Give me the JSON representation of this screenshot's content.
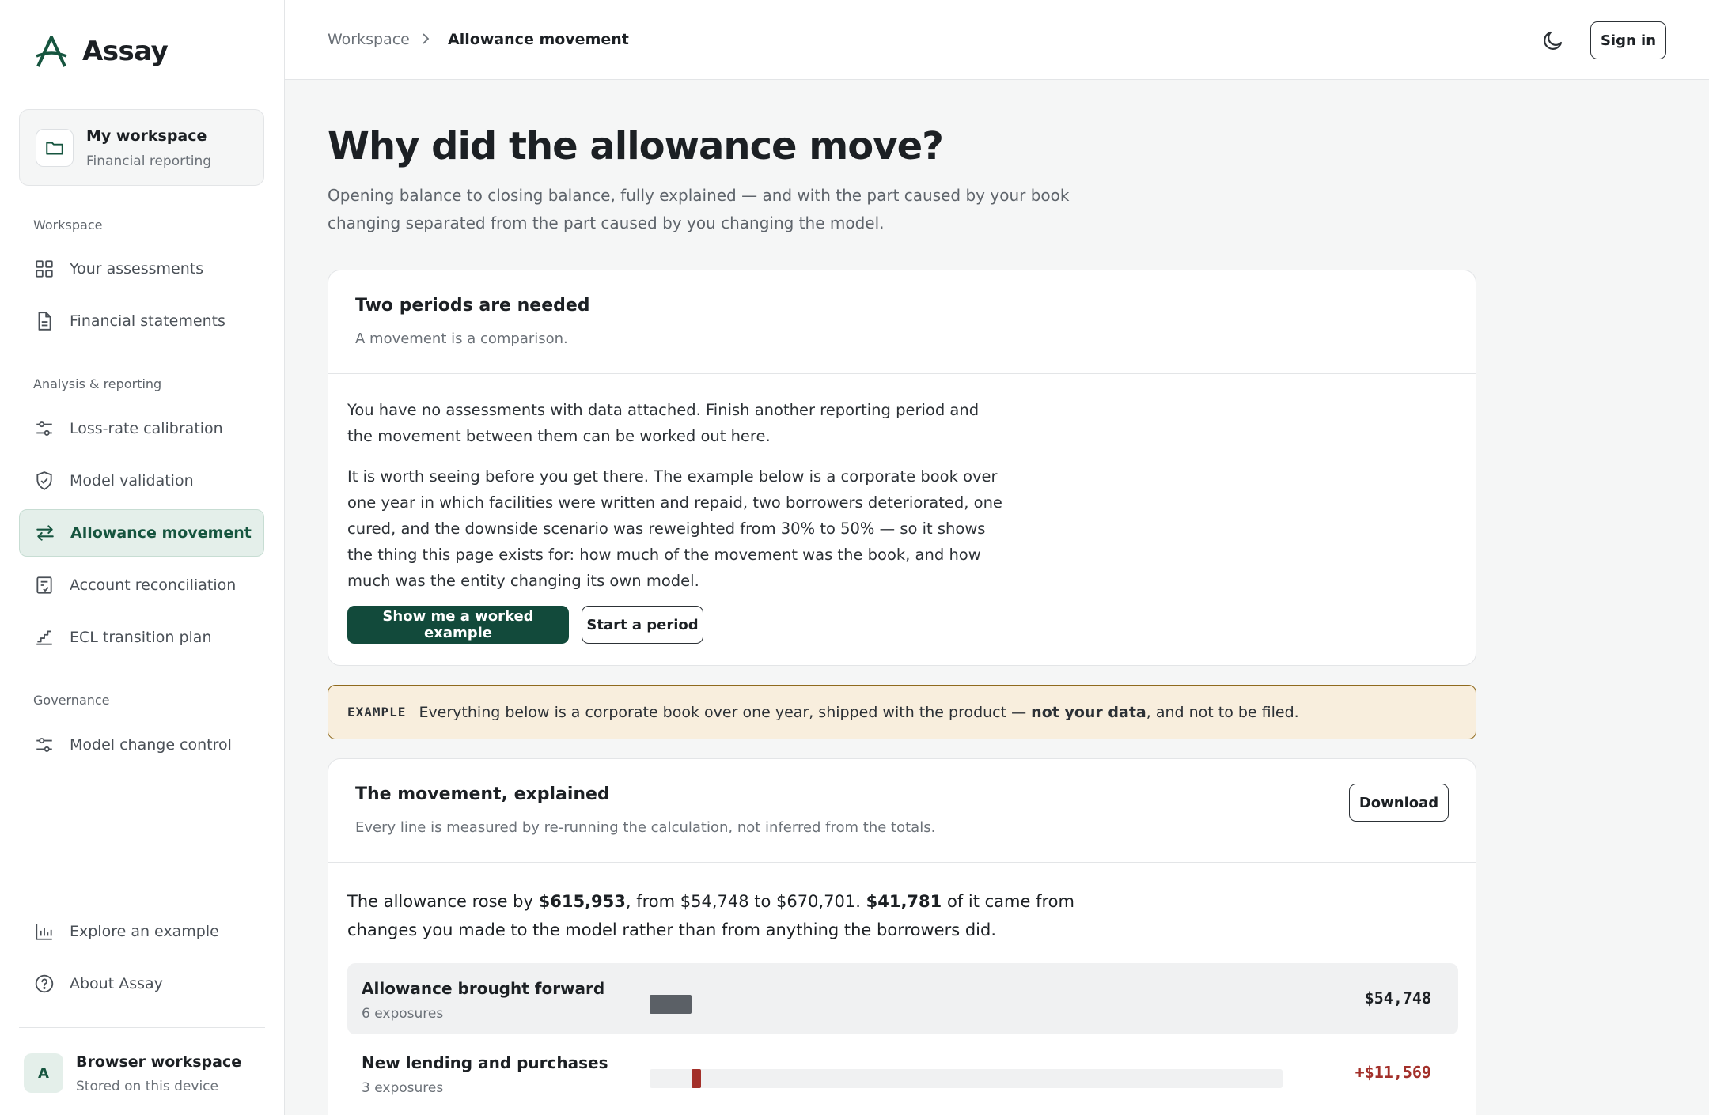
{
  "app": {
    "name": "Assay"
  },
  "workspace": {
    "title": "My workspace",
    "subtitle": "Financial reporting"
  },
  "sidebar": {
    "sections": [
      {
        "label": "Workspace",
        "items": [
          {
            "label": "Your assessments",
            "icon": "grid-icon"
          },
          {
            "label": "Financial statements",
            "icon": "document-icon"
          }
        ]
      },
      {
        "label": "Analysis & reporting",
        "items": [
          {
            "label": "Loss-rate calibration",
            "icon": "sliders-icon"
          },
          {
            "label": "Model validation",
            "icon": "shield-check-icon"
          },
          {
            "label": "Allowance movement",
            "icon": "swap-arrows-icon",
            "active": true
          },
          {
            "label": "Account reconciliation",
            "icon": "checklist-icon"
          },
          {
            "label": "ECL transition plan",
            "icon": "stairs-icon"
          }
        ]
      },
      {
        "label": "Governance",
        "items": [
          {
            "label": "Model change control",
            "icon": "sliders-icon"
          }
        ]
      }
    ],
    "footer_items": [
      {
        "label": "Explore an example",
        "icon": "bar-chart-icon"
      },
      {
        "label": "About Assay",
        "icon": "help-circle-icon"
      }
    ],
    "account": {
      "initial": "A",
      "title": "Browser workspace",
      "subtitle": "Stored on this device"
    }
  },
  "topbar": {
    "breadcrumb_root": "Workspace",
    "breadcrumb_current": "Allowance movement",
    "signin_label": "Sign in"
  },
  "page": {
    "title": "Why did the allowance move?",
    "lede": "Opening balance to closing balance, fully explained — and with the part caused by your book changing separated from the part caused by you changing the model."
  },
  "empty_card": {
    "title": "Two periods are needed",
    "subtitle": "A movement is a comparison.",
    "para1": "You have no assessments with data attached. Finish another reporting period and the movement between them can be worked out here.",
    "para2": "It is worth seeing before you get there. The example below is a corporate book over one year in which facilities were written and repaid, two borrowers deteriorated, one cured, and the downside scenario was reweighted from 30% to 50% — so it shows the thing this page exists for: how much of the movement was the book, and how much was the entity changing its own model.",
    "primary_label": "Show me a worked example",
    "secondary_label": "Start a period"
  },
  "banner": {
    "tag": "EXAMPLE",
    "text_before": "Everything below is a corporate book over one year, shipped with the product — ",
    "text_bold": "not your data",
    "text_after": ", and not to be filed."
  },
  "movement_card": {
    "title": "The movement, explained",
    "subtitle": "Every line is measured by re-running the calculation, not inferred from the totals.",
    "download_label": "Download",
    "summary": {
      "p1": "The allowance rose by ",
      "b1": "$615,953",
      "p2": ", from $54,748 to $670,701. ",
      "b2": "$41,781",
      "p3": " of it came from changes you made to the model rather than from anything the borrowers did."
    },
    "rows": [
      {
        "label": "Allowance brought forward",
        "count": "6 exposures",
        "value": "$54,748",
        "amount": 54748,
        "kind": "opening",
        "color": "#5b6066"
      },
      {
        "label": "New lending and purchases",
        "count": "3 exposures",
        "value": "+$11,569",
        "amount": 11569,
        "kind": "increase",
        "color": "#a3302a"
      }
    ]
  },
  "colors": {
    "accent": "#124a3b",
    "active_bg": "#e4efea",
    "banner_bg": "#f8eedd",
    "banner_border": "#8f6a1e",
    "increase": "#a3302a"
  }
}
